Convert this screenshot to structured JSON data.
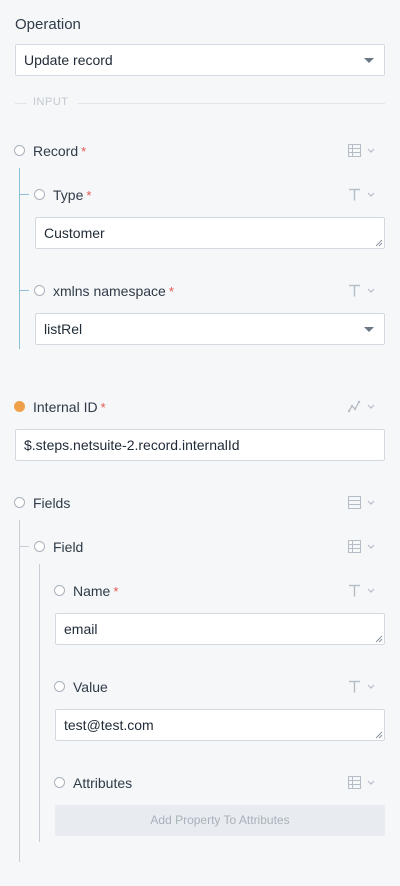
{
  "operation": {
    "label": "Operation",
    "value": "Update record"
  },
  "section_input": "INPUT",
  "record": {
    "label": "Record",
    "required": "*",
    "type": {
      "label": "Type",
      "required": "*",
      "value": "Customer"
    },
    "xmlns": {
      "label": "xmlns namespace",
      "required": "*",
      "value": "listRel"
    }
  },
  "internal_id": {
    "label": "Internal ID",
    "required": "*",
    "value": "$.steps.netsuite-2.record.internalId"
  },
  "fields": {
    "label": "Fields",
    "field": {
      "label": "Field",
      "name": {
        "label": "Name",
        "required": "*",
        "value": "email"
      },
      "value": {
        "label": "Value",
        "value": "test@test.com"
      },
      "attributes": {
        "label": "Attributes",
        "add_label": "Add Property To Attributes"
      }
    }
  },
  "icons": {
    "list": "list-icon",
    "text": "text-type-icon",
    "chart": "line-chart-icon",
    "menu": "menu-icon",
    "chevron": "chevron-down-icon"
  },
  "colors": {
    "accent_line": "#8fbfd6",
    "required": "#e2574c",
    "filled_dot": "#f0a04b"
  }
}
